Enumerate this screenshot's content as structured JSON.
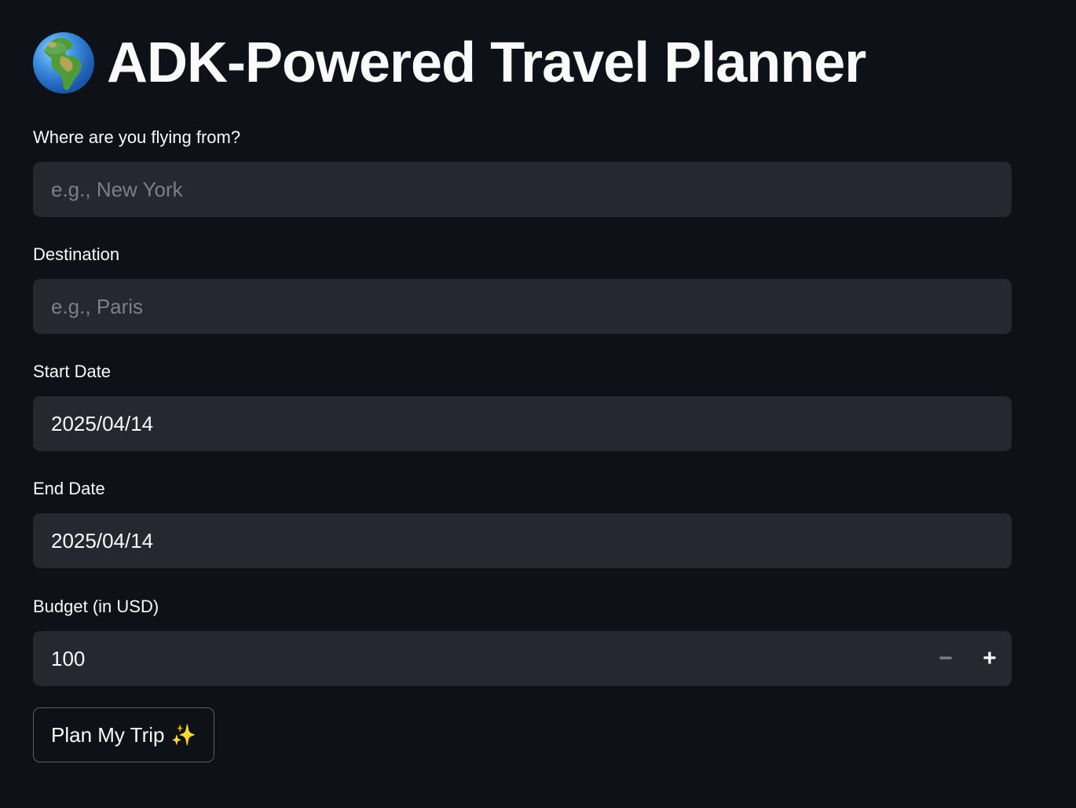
{
  "header": {
    "icon": "globe-europe-africa-icon",
    "title": "ADK-Powered Travel Planner"
  },
  "form": {
    "origin": {
      "label": "Where are you flying from?",
      "value": "",
      "placeholder": "e.g., New York"
    },
    "destination": {
      "label": "Destination",
      "value": "",
      "placeholder": "e.g., Paris"
    },
    "start_date": {
      "label": "Start Date",
      "value": "2025/04/14"
    },
    "end_date": {
      "label": "End Date",
      "value": "2025/04/14"
    },
    "budget": {
      "label": "Budget (in USD)",
      "value": "100",
      "decrement_symbol": "−",
      "increment_symbol": "+"
    },
    "submit": {
      "label": "Plan My Trip",
      "icon": "sparkles-icon",
      "icon_glyph": "✨"
    }
  },
  "colors": {
    "background": "#0e1117",
    "input_background": "#262730",
    "text": "#fafafa",
    "placeholder": "#7c7e89"
  }
}
